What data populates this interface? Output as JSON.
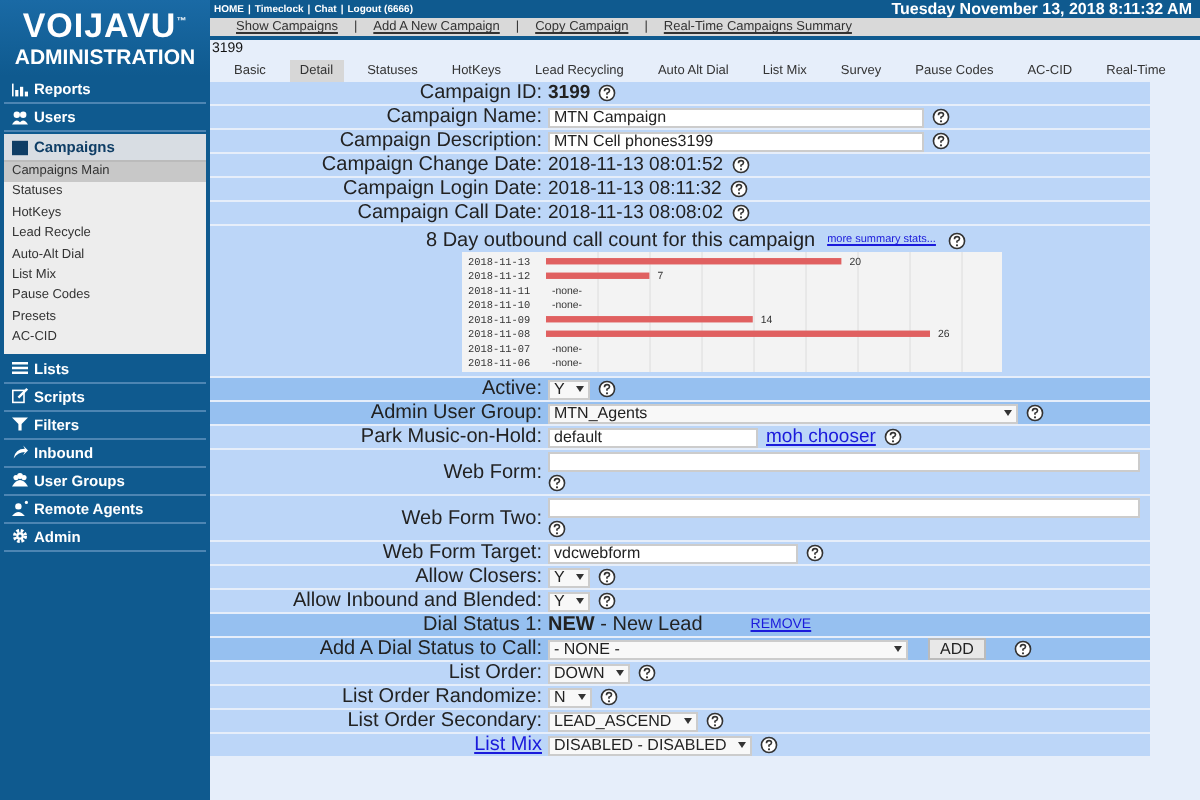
{
  "header": {
    "top_links": [
      "HOME",
      "Timeclock",
      "Chat",
      "Logout (6666)"
    ],
    "separator": "|",
    "datetime": "Tuesday November 13, 2018 8:11:32 AM"
  },
  "sidebar": {
    "logo": "VOIJAVU",
    "trademark": "™",
    "subtitle": "ADMINISTRATION",
    "sections": [
      {
        "label": "Reports",
        "expanded": false
      },
      {
        "label": "Users",
        "expanded": false
      },
      {
        "label": "Campaigns",
        "expanded": true,
        "children": [
          {
            "label": "Campaigns Main",
            "selected": true
          },
          {
            "label": "Statuses",
            "selected": false
          },
          {
            "label": "HotKeys",
            "selected": false
          },
          {
            "label": "Lead Recycle",
            "selected": false
          },
          {
            "label": "Auto-Alt Dial",
            "selected": false
          },
          {
            "label": "List Mix",
            "selected": false
          },
          {
            "label": "Pause Codes",
            "selected": false
          },
          {
            "label": "Presets",
            "selected": false
          },
          {
            "label": "AC-CID",
            "selected": false
          }
        ]
      },
      {
        "label": "Lists",
        "expanded": false
      },
      {
        "label": "Scripts",
        "expanded": false
      },
      {
        "label": "Filters",
        "expanded": false
      },
      {
        "label": "Inbound",
        "expanded": false
      },
      {
        "label": "User Groups",
        "expanded": false
      },
      {
        "label": "Remote Agents",
        "expanded": false
      },
      {
        "label": "Admin",
        "expanded": false
      }
    ]
  },
  "nav_links": {
    "items": [
      "Show Campaigns",
      "Add A New Campaign",
      "Copy Campaign",
      "Real-Time Campaigns Summary"
    ],
    "separator": "|"
  },
  "campaign_heading": "3199",
  "tabs": [
    {
      "label": "Basic",
      "selected": false
    },
    {
      "label": "Detail",
      "selected": true
    },
    {
      "label": "Statuses",
      "selected": false
    },
    {
      "label": "HotKeys",
      "selected": false
    },
    {
      "label": "Lead Recycling",
      "selected": false
    },
    {
      "label": "Auto Alt Dial",
      "selected": false
    },
    {
      "label": "List Mix",
      "selected": false
    },
    {
      "label": "Survey",
      "selected": false
    },
    {
      "label": "Pause Codes",
      "selected": false
    },
    {
      "label": "AC-CID",
      "selected": false
    },
    {
      "label": "Real-Time",
      "selected": false
    }
  ],
  "form": {
    "rows": [
      {
        "kind": "text",
        "label": "Campaign ID:",
        "label_link": false,
        "value": "3199",
        "bold": true,
        "help": true,
        "highlighted": false
      },
      {
        "kind": "input",
        "label": "Campaign Name:",
        "label_link": false,
        "value": "MTN Campaign",
        "help": true,
        "highlighted": false
      },
      {
        "kind": "input",
        "label": "Campaign Description:",
        "label_link": false,
        "value": "MTN Cell phones3199",
        "help": true,
        "highlighted": false
      },
      {
        "kind": "text",
        "label": "Campaign Change Date:",
        "label_link": false,
        "value": "2018-11-13 08:01:52",
        "bold": false,
        "help": true,
        "highlighted": false
      },
      {
        "kind": "text",
        "label": "Campaign Login Date:",
        "label_link": false,
        "value": "2018-11-13 08:11:32",
        "bold": false,
        "help": true,
        "highlighted": false
      },
      {
        "kind": "text",
        "label": "Campaign Call Date:",
        "label_link": false,
        "value": "2018-11-13 08:08:02",
        "bold": false,
        "help": true,
        "highlighted": false
      },
      {
        "kind": "chart",
        "link": "more summary stats...",
        "help": true,
        "highlighted": false,
        "chart_data": {
          "type": "bar",
          "orientation": "horizontal",
          "title": "8 Day outbound call count for this campaign",
          "categories": [
            "2018-11-13",
            "2018-11-12",
            "2018-11-11",
            "2018-11-10",
            "2018-11-09",
            "2018-11-08",
            "2018-11-07",
            "2018-11-06"
          ],
          "values": [
            20,
            7,
            null,
            null,
            14,
            26,
            null,
            null
          ],
          "value_labels": [
            "20",
            "7",
            "-none-",
            "-none-",
            "14",
            "26",
            "-none-",
            "-none-"
          ]
        }
      },
      {
        "kind": "select",
        "label": "Active:",
        "label_link": false,
        "value": "Y",
        "help": true,
        "highlighted": true
      },
      {
        "kind": "wide_select",
        "label": "Admin User Group:",
        "label_link": false,
        "value": "MTN_Agents",
        "help": true,
        "highlighted": true
      },
      {
        "kind": "input_link",
        "label": "Park Music-on-Hold:",
        "label_link": false,
        "value": "default",
        "link": "moh chooser",
        "help": true,
        "highlighted": false
      },
      {
        "kind": "wide_input",
        "label": "Web Form:",
        "label_link": false,
        "help": true,
        "highlighted": false
      },
      {
        "kind": "wide_input",
        "label": "Web Form Two:",
        "label_link": false,
        "help": true,
        "highlighted": false
      },
      {
        "kind": "short_input",
        "label": "Web Form Target:",
        "label_link": false,
        "value": "vdcwebform",
        "help": true,
        "highlighted": false
      },
      {
        "kind": "select",
        "label": "Allow Closers:",
        "label_link": false,
        "value": "Y",
        "help": true,
        "highlighted": false
      },
      {
        "kind": "select",
        "label": "Allow Inbound and Blended:",
        "label_link": false,
        "value": "Y",
        "help": true,
        "highlighted": false
      },
      {
        "kind": "status",
        "label": "Dial Status 1:",
        "label_link": false,
        "value": "**NEW** - New Lead",
        "link": "REMOVE",
        "help": false,
        "highlighted": true
      },
      {
        "kind": "select_button",
        "label": "Add A Dial Status to Call:",
        "label_link": false,
        "value": "- NONE -",
        "button": "ADD",
        "help": true,
        "highlighted": true
      },
      {
        "kind": "select",
        "label": "List Order:",
        "label_link": false,
        "value": "DOWN",
        "help": true,
        "highlighted": false
      },
      {
        "kind": "select",
        "label": "List Order Randomize:",
        "label_link": false,
        "value": "N",
        "help": true,
        "highlighted": false
      },
      {
        "kind": "select",
        "label": "List Order Secondary:",
        "label_link": false,
        "value": "LEAD_ASCEND",
        "help": true,
        "highlighted": false
      },
      {
        "kind": "select",
        "label": "List Mix",
        "label_link": true,
        "value": "DISABLED - DISABLED",
        "help": true,
        "highlighted": false
      }
    ]
  }
}
